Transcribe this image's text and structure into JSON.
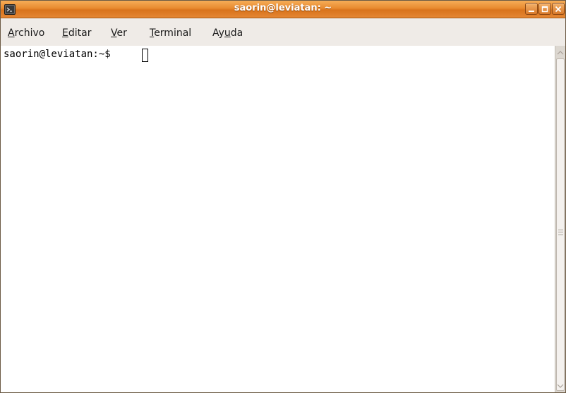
{
  "window": {
    "title": "saorin@leviatan: ~",
    "icon": "terminal-icon",
    "controls": {
      "minimize": "minimize-icon",
      "maximize": "maximize-icon",
      "close": "close-icon"
    },
    "accent_color": "#e88a2f"
  },
  "menubar": {
    "items": [
      {
        "pre": "",
        "mnemonic": "A",
        "post": "rchivo"
      },
      {
        "pre": "",
        "mnemonic": "E",
        "post": "ditar"
      },
      {
        "pre": "",
        "mnemonic": "V",
        "post": "er"
      },
      {
        "pre": "",
        "mnemonic": "T",
        "post": "erminal"
      },
      {
        "pre": "Ay",
        "mnemonic": "u",
        "post": "da"
      }
    ]
  },
  "terminal": {
    "prompt": "saorin@leviatan:~$ ",
    "background": "#ffffff",
    "foreground": "#000000"
  },
  "scrollbar": {
    "up_icon": "scroll-up-arrow-icon",
    "down_icon": "scroll-down-arrow-icon"
  }
}
